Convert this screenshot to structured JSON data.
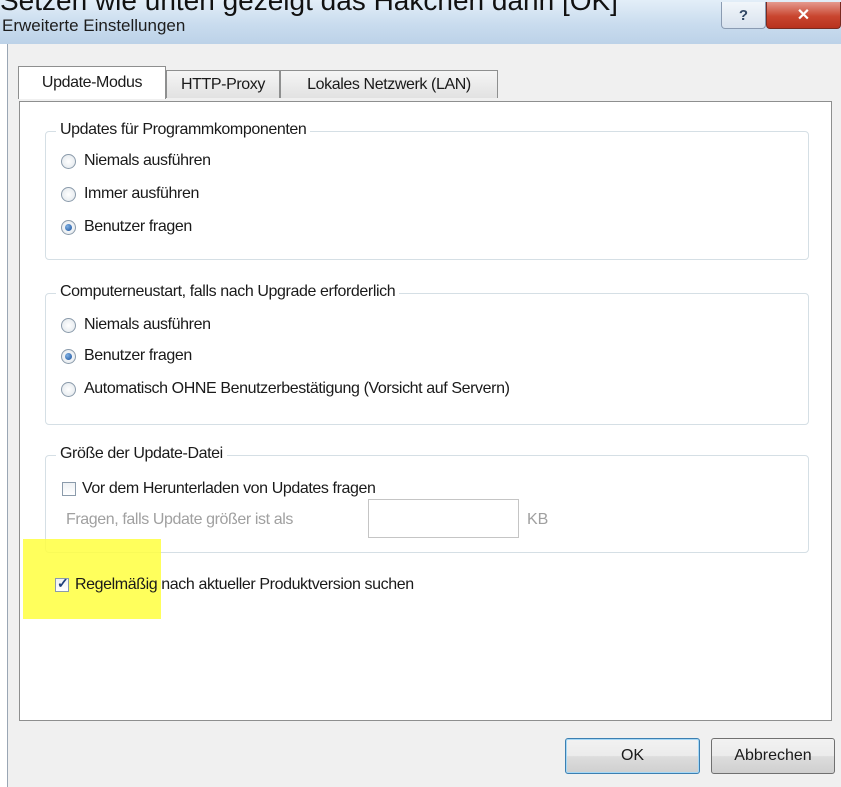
{
  "caption": "Setzen wie unten gezeigt das Häkchen dann [OK]",
  "window": {
    "title": "Erweiterte Einstellungen",
    "help_label": "?",
    "close_label": "✕"
  },
  "tabs": [
    {
      "label": "Update-Modus",
      "active": true
    },
    {
      "label": "HTTP-Proxy",
      "active": false
    },
    {
      "label": "Lokales Netzwerk (LAN)",
      "active": false
    }
  ],
  "group_updates": {
    "legend": "Updates für Programmkomponenten",
    "options": [
      {
        "label": "Niemals ausführen",
        "checked": false
      },
      {
        "label": "Immer ausführen",
        "checked": false
      },
      {
        "label": "Benutzer fragen",
        "checked": true
      }
    ]
  },
  "group_restart": {
    "legend": "Computerneustart, falls nach Upgrade erforderlich",
    "options": [
      {
        "label": "Niemals ausführen",
        "checked": false
      },
      {
        "label": "Benutzer fragen",
        "checked": true
      },
      {
        "label": "Automatisch OHNE Benutzerbestätigung (Vorsicht auf Servern)",
        "checked": false
      }
    ]
  },
  "group_size": {
    "legend": "Größe der Update-Datei",
    "ask_before_download": {
      "label": "Vor dem Herunterladen von Updates fragen",
      "checked": false
    },
    "threshold_label": "Fragen, falls Update größer ist als",
    "threshold_value": "",
    "unit": "KB"
  },
  "periodic_check": {
    "label": "Regelmäßig nach aktueller Produktversion suchen",
    "checked": true
  },
  "buttons": {
    "ok": "OK",
    "cancel": "Abbrechen"
  },
  "colors": {
    "highlight": "#ffff40",
    "close_button": "#c9452f"
  }
}
